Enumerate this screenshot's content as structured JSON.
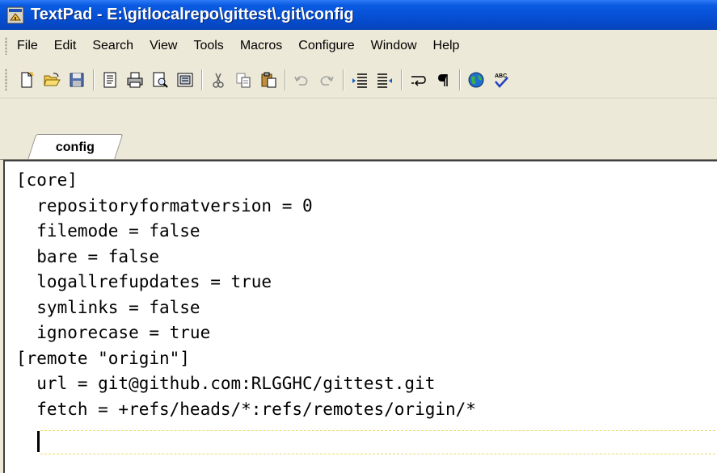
{
  "window": {
    "title": "TextPad - E:\\gitlocalrepo\\gittest\\.git\\config"
  },
  "menu": {
    "items": [
      "File",
      "Edit",
      "Search",
      "View",
      "Tools",
      "Macros",
      "Configure",
      "Window",
      "Help"
    ]
  },
  "toolbar": {
    "buttons": [
      "new-document-icon",
      "open-folder-icon",
      "save-icon",
      "document-properties-icon",
      "print-icon",
      "print-preview-icon",
      "workspace-icon",
      "cut-icon",
      "copy-icon",
      "paste-icon",
      "undo-icon",
      "redo-icon",
      "indent-icon",
      "outdent-icon",
      "word-wrap-icon",
      "pilcrow-icon",
      "web-globe-icon",
      "spell-check-icon"
    ]
  },
  "tabs": [
    {
      "label": "config",
      "active": true
    }
  ],
  "editor": {
    "lines": [
      "[core]",
      "  repositoryformatversion = 0",
      "  filemode = false",
      "  bare = false",
      "  logallrefupdates = true",
      "  symlinks = false",
      "  ignorecase = true",
      "[remote \"origin\"]",
      "  url = git@github.com:RLGGHC/gittest.git",
      "  fetch = +refs/heads/*:refs/remotes/origin/*",
      ""
    ]
  },
  "colors": {
    "titlebar": "#0a5be2",
    "chrome": "#ece9d8",
    "editor_bg": "#ffffff",
    "current_line": "#e8d96a"
  }
}
